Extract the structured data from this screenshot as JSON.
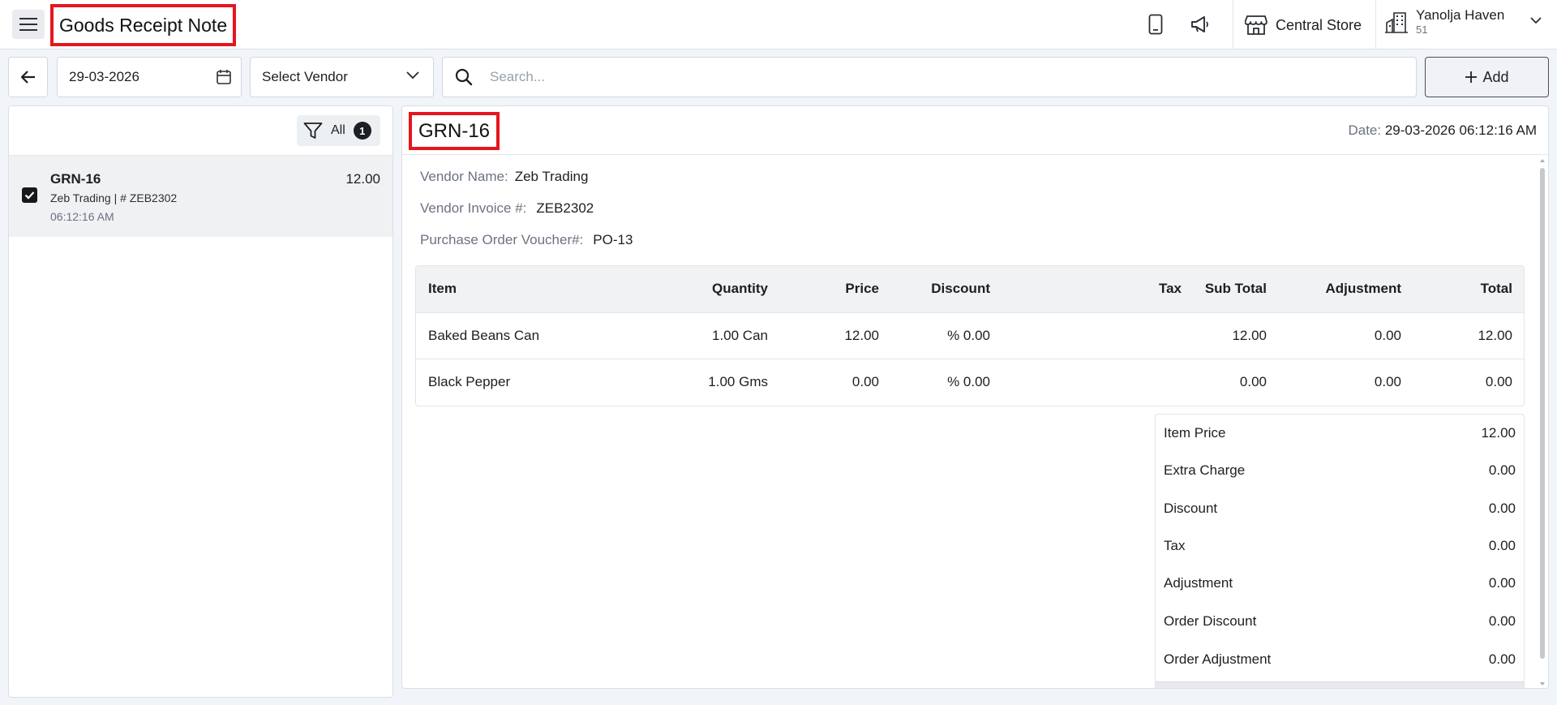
{
  "header": {
    "title": "Goods Receipt Note",
    "store_name": "Central Store",
    "org_name": "Yanolja Haven",
    "org_sub": "51",
    "icons": [
      "menu-icon",
      "mobile-icon",
      "megaphone-icon",
      "store-icon",
      "building-icon",
      "chevron-down-icon"
    ]
  },
  "toolbar": {
    "date_value": "29-03-2026",
    "vendor_placeholder": "Select Vendor",
    "search_placeholder": "Search...",
    "add_label": "Add"
  },
  "list": {
    "filter_label": "All",
    "filter_count": "1",
    "items": [
      {
        "title": "GRN-16",
        "subtitle": "Zeb Trading | # ZEB2302",
        "time": "06:12:16 AM",
        "amount": "12.00",
        "checked": true
      }
    ]
  },
  "detail": {
    "title": "GRN-16",
    "date_label": "Date:",
    "date_value": "29-03-2026 06:12:16 AM",
    "vendor_name_label": "Vendor Name:",
    "vendor_name": "Zeb Trading",
    "vendor_invoice_label": "Vendor Invoice #:",
    "vendor_invoice": "ZEB2302",
    "po_label": "Purchase Order Voucher#:",
    "po_value": "PO-13",
    "table": {
      "headers": {
        "item": "Item",
        "quantity": "Quantity",
        "price": "Price",
        "discount": "Discount",
        "tax": "Tax",
        "sub_total": "Sub Total",
        "adjustment": "Adjustment",
        "total": "Total"
      },
      "rows": [
        {
          "item": "Baked Beans Can",
          "quantity": "1.00 Can",
          "price": "12.00",
          "discount": "% 0.00",
          "tax": "",
          "sub_total": "12.00",
          "adjustment": "0.00",
          "total": "12.00"
        },
        {
          "item": "Black Pepper",
          "quantity": "1.00 Gms",
          "price": "0.00",
          "discount": "% 0.00",
          "tax": "",
          "sub_total": "0.00",
          "adjustment": "0.00",
          "total": "0.00"
        }
      ]
    },
    "summary": [
      {
        "label": "Item Price",
        "value": "12.00"
      },
      {
        "label": "Extra Charge",
        "value": "0.00"
      },
      {
        "label": "Discount",
        "value": "0.00"
      },
      {
        "label": "Tax",
        "value": "0.00"
      },
      {
        "label": "Adjustment",
        "value": "0.00"
      },
      {
        "label": "Order Discount",
        "value": "0.00"
      },
      {
        "label": "Order Adjustment",
        "value": "0.00"
      }
    ]
  }
}
